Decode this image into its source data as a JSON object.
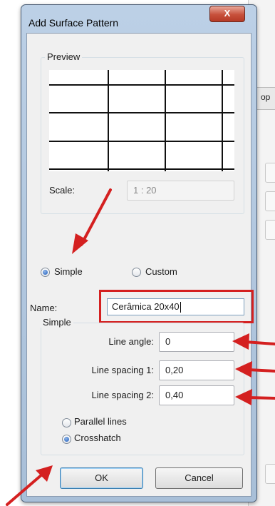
{
  "dialog": {
    "title": "Add Surface Pattern",
    "close_glyph": "X"
  },
  "background": {
    "tab_label": "op"
  },
  "preview": {
    "group_label": "Preview",
    "scale_label": "Scale:",
    "scale_value": "1 : 20"
  },
  "pattern_type": {
    "options": [
      {
        "label": "Simple",
        "selected": true
      },
      {
        "label": "Custom",
        "selected": false
      }
    ]
  },
  "name": {
    "label": "Name:",
    "value": "Cerâmica 20x40"
  },
  "simple": {
    "group_label": "Simple",
    "line_angle_label": "Line angle:",
    "line_angle_value": "0",
    "line_spacing1_label": "Line spacing 1:",
    "line_spacing1_value": "0,20",
    "line_spacing2_label": "Line spacing 2:",
    "line_spacing2_value": "0,40",
    "hatch_options": [
      {
        "label": "Parallel lines",
        "selected": false
      },
      {
        "label": "Crosshatch",
        "selected": true
      }
    ]
  },
  "buttons": {
    "ok_label": "OK",
    "cancel_label": "Cancel"
  },
  "colors": {
    "annotation_red": "#d42020",
    "title_bar": "#b6cbe3",
    "close_button": "#c7503b"
  }
}
